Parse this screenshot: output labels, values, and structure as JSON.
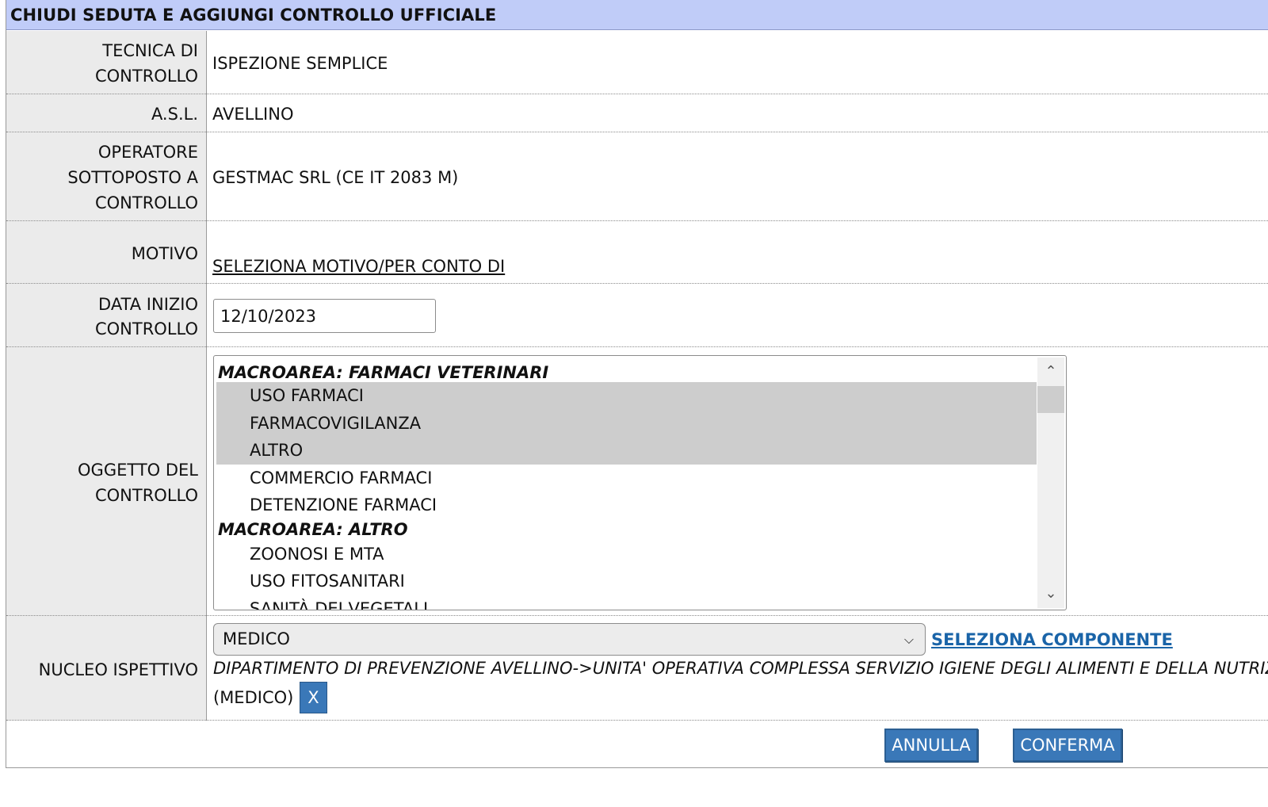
{
  "title": "CHIUDI SEDUTA E AGGIUNGI CONTROLLO UFFICIALE",
  "fields": {
    "tecnica": {
      "label_l1": "TECNICA DI",
      "label_l2": "CONTROLLO",
      "value": "ISPEZIONE SEMPLICE"
    },
    "asl": {
      "label": "A.S.L.",
      "value": "AVELLINO"
    },
    "operatore": {
      "label_l1": "OPERATORE",
      "label_l2": "SOTTOPOSTO A",
      "label_l3": "CONTROLLO",
      "value": "GESTMAC SRL (CE IT 2083 M)"
    },
    "motivo": {
      "label": "MOTIVO",
      "link": "SELEZIONA MOTIVO/PER CONTO DI"
    },
    "data_inizio": {
      "label_l1": "DATA INIZIO",
      "label_l2": "CONTROLLO",
      "value": "12/10/2023"
    },
    "oggetto": {
      "label_l1": "OGGETTO DEL",
      "label_l2": "CONTROLLO",
      "items": [
        {
          "text": "MACROAREA: FARMACI VETERINARI",
          "group": true
        },
        {
          "text": "USO FARMACI",
          "selected": true
        },
        {
          "text": "FARMACOVIGILANZA",
          "selected": true
        },
        {
          "text": "ALTRO",
          "selected": true
        },
        {
          "text": "COMMERCIO FARMACI"
        },
        {
          "text": "DETENZIONE FARMACI"
        },
        {
          "text": "MACROAREA: ALTRO",
          "group": true
        },
        {
          "text": "ZOONOSI E MTA"
        },
        {
          "text": "USO FITOSANITARI"
        },
        {
          "text": "SANITÀ DEI VEGETALI"
        }
      ]
    },
    "nucleo": {
      "label": "NUCLEO ISPETTIVO",
      "select_value": "MEDICO",
      "select_link": "SELEZIONA COMPONENTE",
      "member_dept": "DIPARTIMENTO DI PREVENZIONE AVELLINO->UNITA' OPERATIVA COMPLESSA SERVIZIO IGIENE DEGLI ALIMENTI E DELLA NUTRIZIONE",
      "member_role": "(MEDICO)",
      "remove_label": "X"
    }
  },
  "buttons": {
    "annulla": "ANNULLA",
    "conferma": "CONFERMA"
  },
  "colors": {
    "title_bg": "#c0ccf8",
    "button_bg": "#3a78b8",
    "link": "#1a64a8",
    "selected_bg": "#cdcdcd",
    "label_bg": "#ebebeb"
  }
}
